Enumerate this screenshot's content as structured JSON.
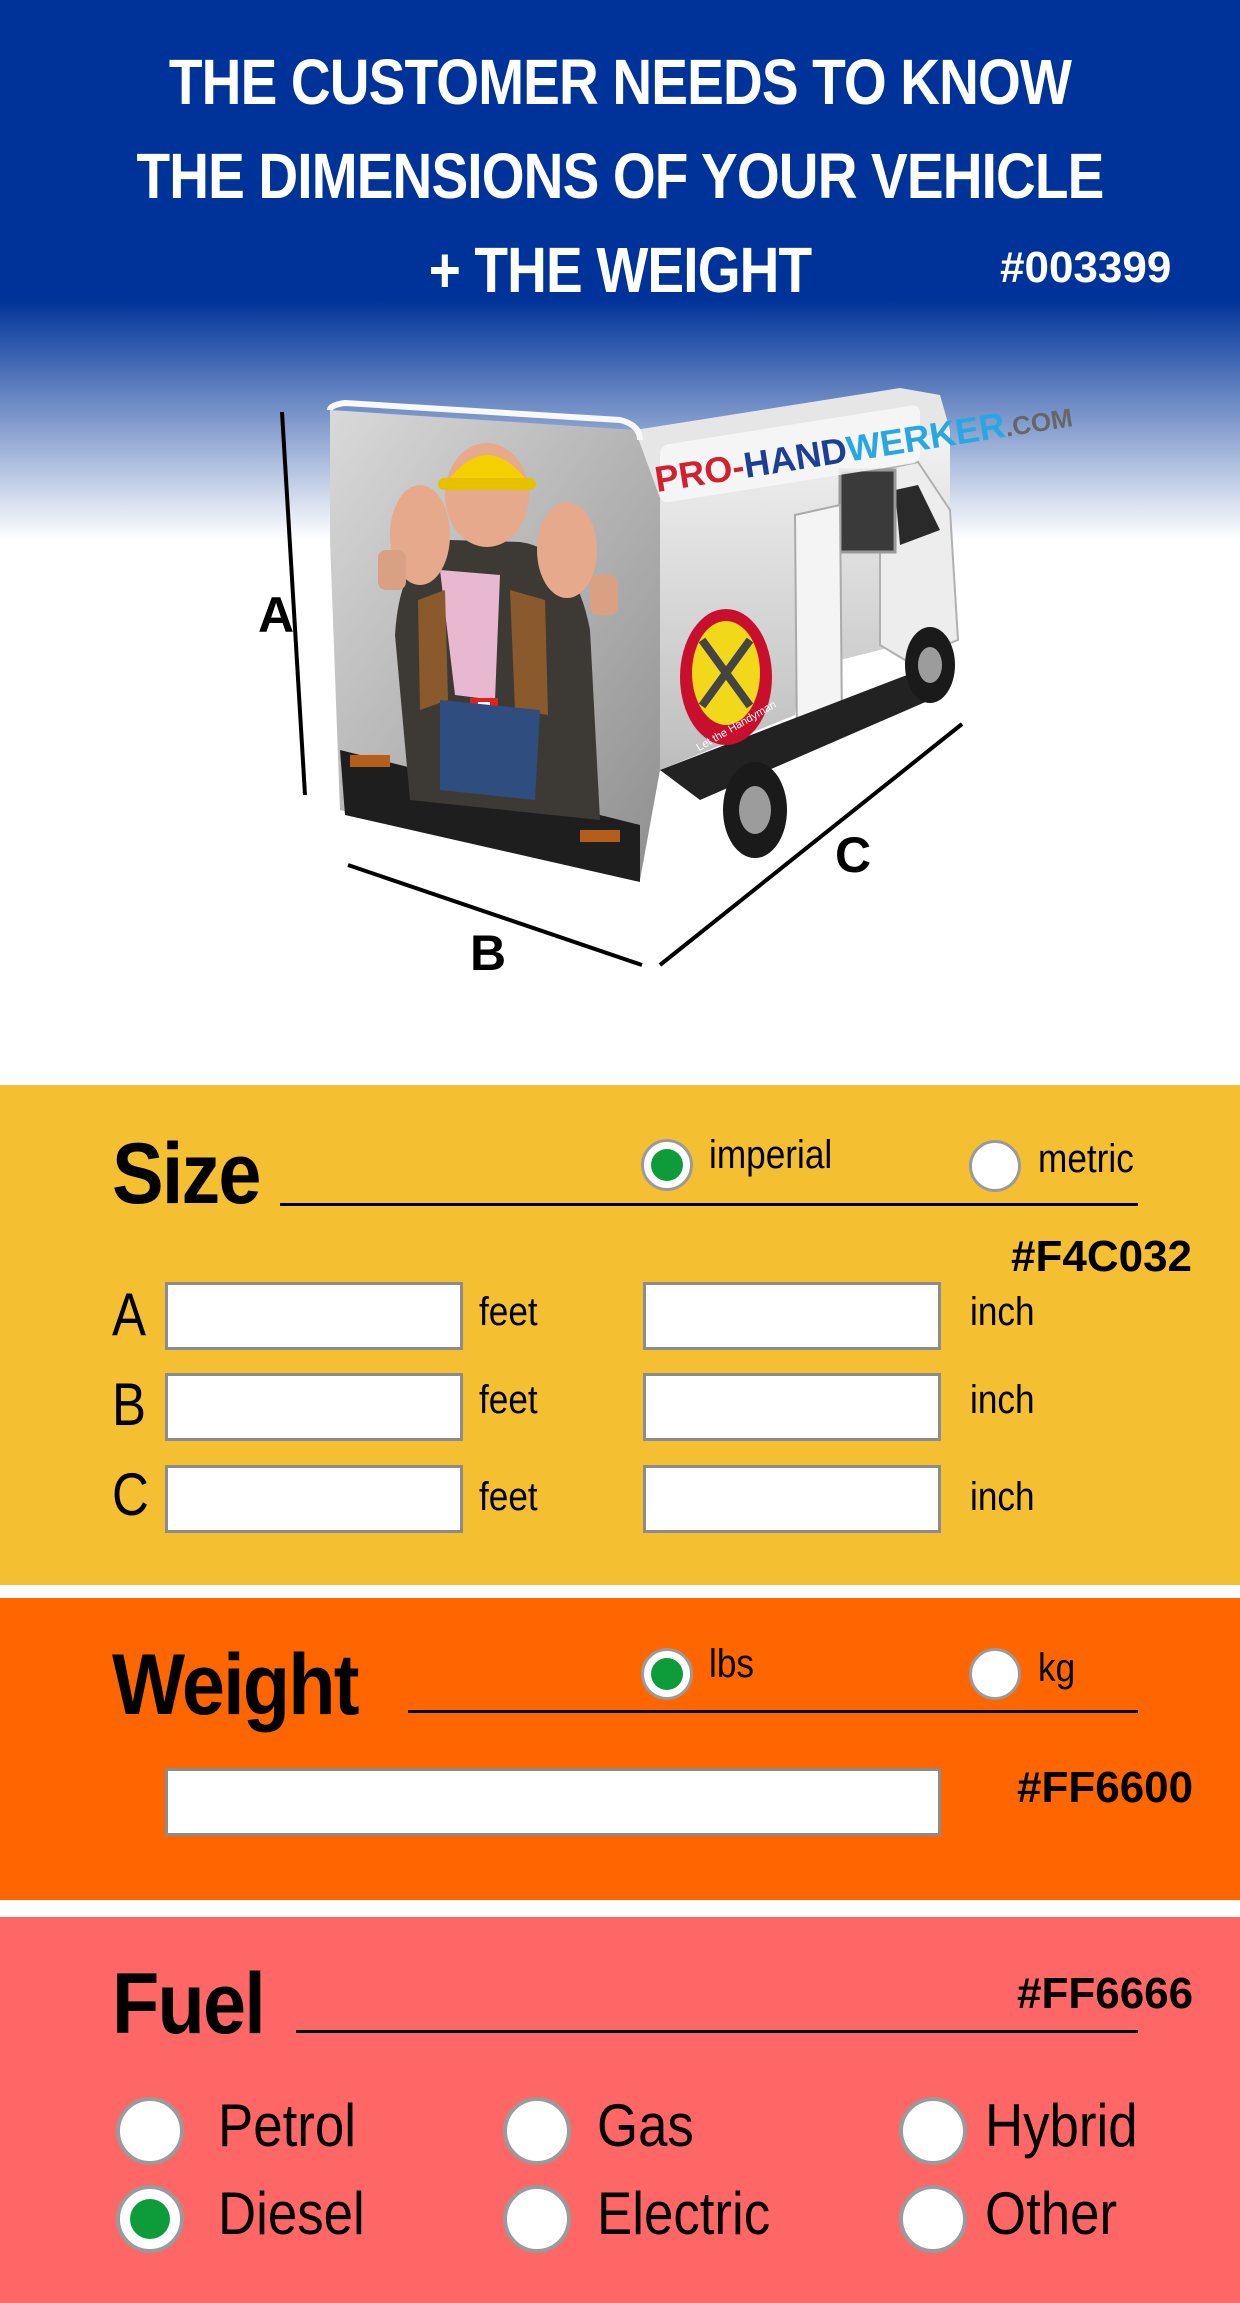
{
  "header": {
    "lines": [
      "THE CUSTOMER NEEDS TO KNOW",
      "THE DIMENSIONS OF YOUR VEHICLE",
      "+ THE WEIGHT"
    ],
    "color_code": "#003399"
  },
  "illustration": {
    "brand_pro": "PRO-",
    "brand_hand": "HAND",
    "brand_werker": "WERKER",
    "brand_com": ".COM",
    "badge_text": "Let the Handyman",
    "dim_a": "A",
    "dim_b": "B",
    "dim_c": "C"
  },
  "size": {
    "title": "Size",
    "unit_options": [
      "imperial",
      "metric"
    ],
    "selected": "imperial",
    "color_code": "#F4C032",
    "rows": [
      {
        "letter": "A",
        "feet_value": "",
        "inch_value": ""
      },
      {
        "letter": "B",
        "feet_value": "",
        "inch_value": ""
      },
      {
        "letter": "C",
        "feet_value": "",
        "inch_value": ""
      }
    ],
    "unit_feet": "feet",
    "unit_inch": "inch"
  },
  "weight": {
    "title": "Weight",
    "unit_options": [
      "lbs",
      "kg"
    ],
    "selected": "lbs",
    "color_code": "#FF6600",
    "value": ""
  },
  "fuel": {
    "title": "Fuel",
    "color_code": "#FF6666",
    "options": [
      "Petrol",
      "Gas",
      "Hybrid",
      "Diesel",
      "Electric",
      "Other"
    ],
    "selected": "Diesel"
  },
  "colors": {
    "header_bg": "#003399",
    "size_bg": "#F4C032",
    "weight_bg": "#FF6600",
    "fuel_bg": "#FF6666",
    "radio_checked": "#0e9b3a"
  }
}
